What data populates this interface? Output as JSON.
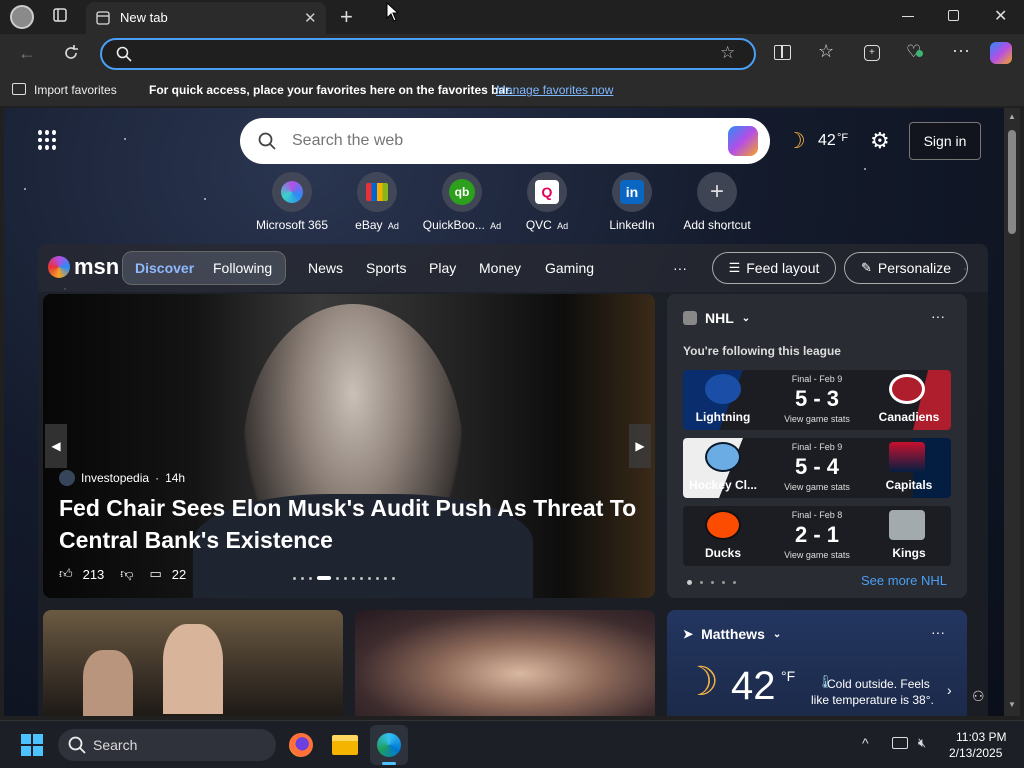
{
  "browser": {
    "tab_title": "New tab",
    "address_value": "",
    "favbar": {
      "import_label": "Import favorites",
      "prompt": "For quick access, place your favorites here on the favorites bar.",
      "manage_link": "Manage favorites now"
    }
  },
  "ntp": {
    "search_placeholder": "Search the web",
    "weather_temp": "42",
    "weather_unit": "°F",
    "sign_in": "Sign in",
    "shortcuts": [
      {
        "label": "Microsoft 365",
        "ad": ""
      },
      {
        "label": "eBay",
        "ad": "Ad"
      },
      {
        "label": "QuickBoo...",
        "ad": "Ad"
      },
      {
        "label": "QVC",
        "ad": "Ad"
      },
      {
        "label": "LinkedIn",
        "ad": ""
      },
      {
        "label": "Add shortcut",
        "ad": ""
      }
    ],
    "msn_logo": "msn",
    "tabs": [
      "Discover",
      "Following"
    ],
    "nav": [
      "News",
      "Sports",
      "Play",
      "Money",
      "Gaming"
    ],
    "more": "···",
    "feed_layout": "Feed layout",
    "personalize": "Personalize"
  },
  "hero": {
    "source": "Investopedia",
    "age": "14h",
    "headline": "Fed Chair Sees Elon Musk's Audit Push As Threat To Central Bank's Existence",
    "likes": "213",
    "comments": "22"
  },
  "nhl": {
    "title": "NHL",
    "subtitle": "You're following this league",
    "games": [
      {
        "status": "Final - Feb 9",
        "home": "Lightning",
        "away": "Canadiens",
        "score": "5 - 3",
        "stats": "View game stats",
        "home_color": "#0a2d6e",
        "away_color": "#af1e2d"
      },
      {
        "status": "Final - Feb 9",
        "home": "Hockey Cl...",
        "away": "Capitals",
        "score": "5 - 4",
        "stats": "View game stats",
        "home_color": "#6cace4",
        "away_color": "#041e42"
      },
      {
        "status": "Final - Feb 8",
        "home": "Ducks",
        "away": "Kings",
        "score": "2 - 1",
        "stats": "View game stats",
        "home_color": "#2a2a2a",
        "away_color": "#2a2a2a"
      }
    ],
    "see_more": "See more NHL"
  },
  "weather_card": {
    "location": "Matthews",
    "temp": "42",
    "unit": "°F",
    "note": "Cold outside. Feels like temperature is 38°."
  },
  "taskbar": {
    "search_label": "Search",
    "time": "11:03 PM",
    "date": "2/13/2025"
  },
  "colors": {
    "accent": "#4a9ff5",
    "edge_blue": "#0078d4"
  }
}
